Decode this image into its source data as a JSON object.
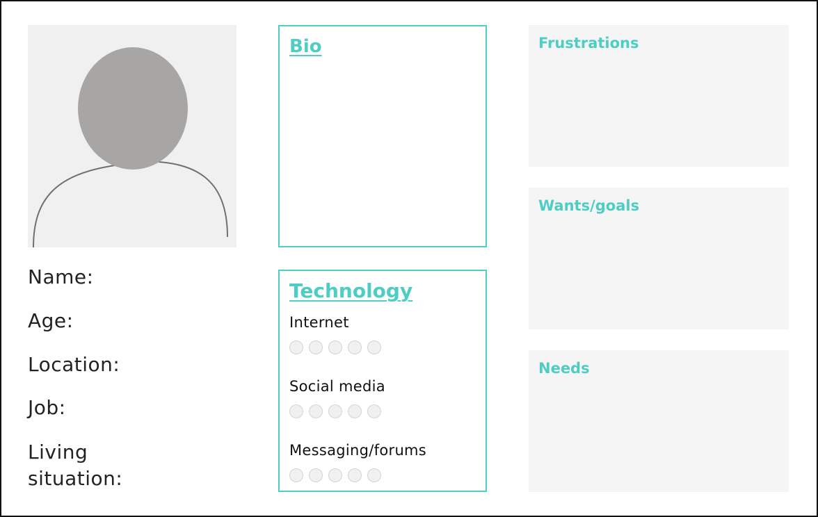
{
  "profile": {
    "avatar_icon": "person-silhouette-icon",
    "fields": [
      "Name:",
      "Age:",
      "Location:",
      "Job:",
      "Living",
      "situation:"
    ]
  },
  "bio": {
    "title": "Bio"
  },
  "technology": {
    "title": "Technology",
    "items": [
      {
        "label": "Internet",
        "rating": 0,
        "scale": 5
      },
      {
        "label": "Social media",
        "rating": 0,
        "scale": 5
      },
      {
        "label": "Messaging/forums",
        "rating": 0,
        "scale": 5
      }
    ]
  },
  "panels": [
    {
      "title": "Frustrations"
    },
    {
      "title": "Wants/goals"
    },
    {
      "title": "Needs"
    }
  ],
  "colors": {
    "accent": "#4ecdc4",
    "panel_background": "#f5f5f5",
    "avatar_background": "#f0f0f0",
    "avatar_head": "#a7a6a5"
  }
}
